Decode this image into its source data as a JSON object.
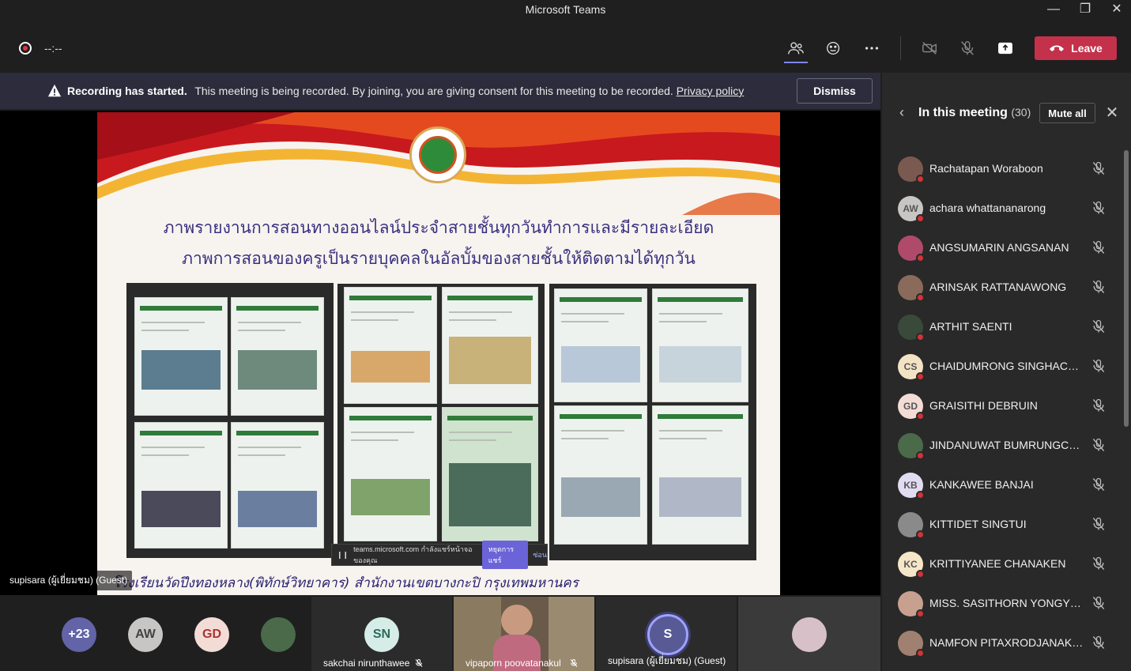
{
  "window": {
    "title": "Microsoft Teams"
  },
  "toolbar": {
    "timer": "--:--",
    "leave_label": "Leave"
  },
  "banner": {
    "bold": "Recording has started.",
    "text": "This meeting is being recorded. By joining, you are giving consent for this meeting to be recorded.",
    "link": "Privacy policy",
    "dismiss_label": "Dismiss"
  },
  "slide": {
    "title_line1": "ภาพรายงานการสอนทางออนไลน์ประจำสายชั้นทุกวันทำการและมีรายละเอียด",
    "title_line2": "ภาพการสอนของครูเป็นรายบุคคลในอัลบั้มของสายชั้นให้ติดตามได้ทุกวัน",
    "footer": "โรงเรียนวัดปึงทองหลาง(พิทักษ์วิทยาคาร) สำนักงานเขตบางกะปิ กรุงเทพมหานคร",
    "share_bar": {
      "text": "teams.microsoft.com กำลังแชร์หน้าจอของคุณ",
      "stop": "หยุดการแชร์",
      "hide": "ซ่อน"
    },
    "presenter_tag": "supisara (ผู้เยี่ยมชม) (Guest)"
  },
  "panel": {
    "title": "In this meeting",
    "count": "(30)",
    "mute_all": "Mute all",
    "participants": [
      {
        "name": "Rachatapan Woraboon",
        "initials": "",
        "color": "#7a5a50"
      },
      {
        "name": "achara whattananarong",
        "initials": "AW",
        "color": "#c8c6c4"
      },
      {
        "name": "ANGSUMARIN ANGSANAN",
        "initials": "",
        "color": "#b04a6a"
      },
      {
        "name": "ARINSAK RATTANAWONG",
        "initials": "",
        "color": "#8a6a5a"
      },
      {
        "name": "ARTHIT SAENTI",
        "initials": "",
        "color": "#3a4a3a"
      },
      {
        "name": "CHAIDUMRONG SINGHACHAI",
        "initials": "CS",
        "color": "#f3e3c5"
      },
      {
        "name": "GRAISITHI DEBRUIN",
        "initials": "GD",
        "color": "#f4dcd6"
      },
      {
        "name": "JINDANUWAT BUMRUNGCHAI",
        "initials": "",
        "color": "#4a6a4a"
      },
      {
        "name": "KANKAWEE BANJAI",
        "initials": "KB",
        "color": "#e2dcf3"
      },
      {
        "name": "KITTIDET SINGTUI",
        "initials": "",
        "color": "#8a8a8a"
      },
      {
        "name": "KRITTIYANEE CHANAKEN",
        "initials": "KC",
        "color": "#f6e6c8"
      },
      {
        "name": "MISS. SASITHORN YONGYUT",
        "initials": "",
        "color": "#c8a090"
      },
      {
        "name": "NAMFON PITAXRODJANAKUL",
        "initials": "",
        "color": "#a08070"
      }
    ]
  },
  "gallery": {
    "overflow": "+23",
    "av1": "AW",
    "av2": "GD",
    "tile_sn": {
      "initials": "SN",
      "name": "sakchai nirunthawee"
    },
    "tile_vp": {
      "name": "vipaporn poovatanakul"
    },
    "tile_s": {
      "initials": "S",
      "name": "supisara (ผู้เยี่ยมชม) (Guest)"
    }
  },
  "colors": {
    "leave": "#c4314b",
    "accent": "#6264a7",
    "banner_bg": "#2d2c3c"
  },
  "icons": [
    "record-icon",
    "people-icon",
    "reactions-icon",
    "more-icon",
    "camera-off-icon",
    "mic-off-icon",
    "share-icon",
    "phone-icon",
    "warning-icon",
    "back-chevron-icon",
    "close-icon"
  ]
}
